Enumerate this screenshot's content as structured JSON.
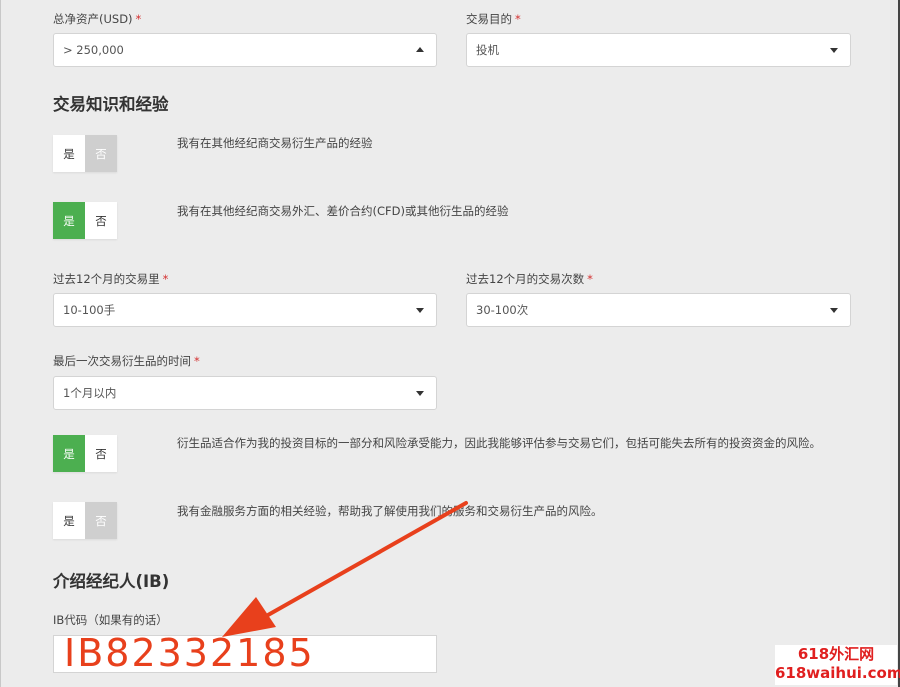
{
  "fields": {
    "net_assets": {
      "label": "总净资产(USD)",
      "required": "*",
      "value": "> 250,000"
    },
    "trading_purpose": {
      "label": "交易目的",
      "required": "*",
      "value": "投机"
    },
    "volume_12m": {
      "label": "过去12个月的交易里",
      "required": "*",
      "value": "10-100手"
    },
    "count_12m": {
      "label": "过去12个月的交易次数",
      "required": "*",
      "value": "30-100次"
    },
    "last_trade": {
      "label": "最后一次交易衍生品的时间",
      "required": "*",
      "value": "1个月以内"
    }
  },
  "sections": {
    "experience_title": "交易知识和经验",
    "ib_title": "介绍经纪人(IB)"
  },
  "toggles": {
    "yes": "是",
    "no": "否",
    "q1": {
      "text": "我有在其他经纪商交易衍生产品的经验",
      "selected": "none"
    },
    "q2": {
      "text": "我有在其他经纪商交易外汇、差价合约(CFD)或其他衍生品的经验",
      "selected": "yes"
    },
    "q3": {
      "text": "衍生品适合作为我的投资目标的一部分和风险承受能力，因此我能够评估参与交易它们，包括可能失去所有的投资资金的风险。",
      "selected": "yes"
    },
    "q4": {
      "text": "我有金融服务方面的相关经验，帮助我了解使用我们的服务和交易衍生产品的风险。",
      "selected": "none"
    }
  },
  "ib": {
    "label": "IB代码（如果有的话）",
    "value": "IB82332185"
  },
  "annotation": {
    "arrow_color": "#e8401c"
  },
  "watermark": {
    "line1": "618外汇网",
    "line2": "618waihui.com"
  }
}
